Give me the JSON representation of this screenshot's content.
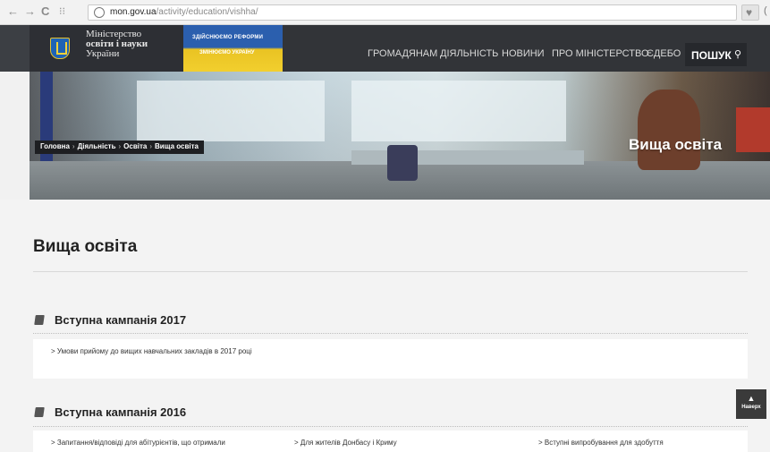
{
  "browser": {
    "url_host": "mon.gov.ua",
    "url_path": "/activity/education/vishha/"
  },
  "header": {
    "logo": {
      "line1": "Міністерство",
      "line2": "освіти і науки",
      "line3": "України"
    },
    "reform_banner": {
      "line1": "ЗДІЙСНЮЄМО РЕФОРМИ",
      "line2": "ЗМІНЮЄМО УКРАЇНУ"
    },
    "menu": [
      "ГРОМАДЯНАМ",
      "ДІЯЛЬНІСТЬ",
      "НОВИНИ",
      "ПРО МІНІСТЕРСТВО",
      "ЄДЕБО"
    ],
    "search_label": "ПОШУК"
  },
  "hero": {
    "breadcrumb": [
      "Головна",
      "Діяльність",
      "Освіта",
      "Вища освіта"
    ],
    "title": "Вища освіта"
  },
  "main": {
    "page_title": "Вища освіта",
    "sections": [
      {
        "title": "Вступна кампанія 2017",
        "links": [
          "> Умови прийому до вищих навчальних закладів в 2017 році"
        ]
      },
      {
        "title": "Вступна кампанія 2016",
        "links": [
          "> Запитання/відповіді для абітурієнтів, що отримали",
          "> Для жителів Донбасу і Криму",
          "> Вступні випробування для здобуття"
        ]
      }
    ]
  },
  "to_top_label": "Наверх"
}
